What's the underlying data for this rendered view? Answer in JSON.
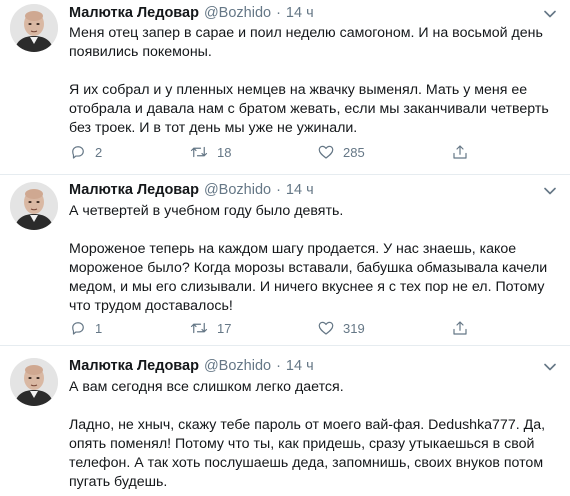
{
  "tweets": [
    {
      "author": "Малютка Ледовар",
      "handle": "@Bozhido",
      "separator": "·",
      "time": "14 ч",
      "paragraphs": [
        "Меня отец запер в сарае и поил неделю самогоном. И на восьмой день появились покемоны.",
        "Я их собрал и у пленных немцев на жвачку выменял. Мать у меня ее отобрала и давала нам с братом жевать, если мы заканчивали четверть без троек. И в тот день мы уже не ужинали."
      ],
      "replies": "2",
      "retweets": "18",
      "likes": "285"
    },
    {
      "author": "Малютка Ледовар",
      "handle": "@Bozhido",
      "separator": "·",
      "time": "14 ч",
      "paragraphs": [
        "А четвертей в учебном году было девять.",
        "Мороженое теперь на каждом шагу продается. У нас знаешь, какое мороженое было? Когда морозы вставали, бабушка обмазывала качели медом, и мы его слизывали. И ничего вкуснее я с тех пор не ел. Потому что трудом доставалось!"
      ],
      "replies": "1",
      "retweets": "17",
      "likes": "319"
    },
    {
      "author": "Малютка Ледовар",
      "handle": "@Bozhido",
      "separator": "·",
      "time": "14 ч",
      "paragraphs": [
        "А вам сегодня все слишком легко дается.",
        "Ладно, не хныч, скажу тебе пароль от моего вай-фая. Dedushka777. Да, опять поменял! Потому что ты, как придешь, сразу утыкаешься в свой телефон. А так хоть послушаешь деда, запомнишь, своих внуков потом пугать будешь."
      ]
    }
  ],
  "icons": {
    "reply": "reply-icon",
    "retweet": "retweet-icon",
    "like": "heart-icon",
    "share": "share-icon",
    "caret": "chevron-down-icon",
    "avatar": "avatar"
  },
  "colors": {
    "text": "#14171a",
    "secondary": "#657786",
    "divider": "#e6ecf0"
  }
}
